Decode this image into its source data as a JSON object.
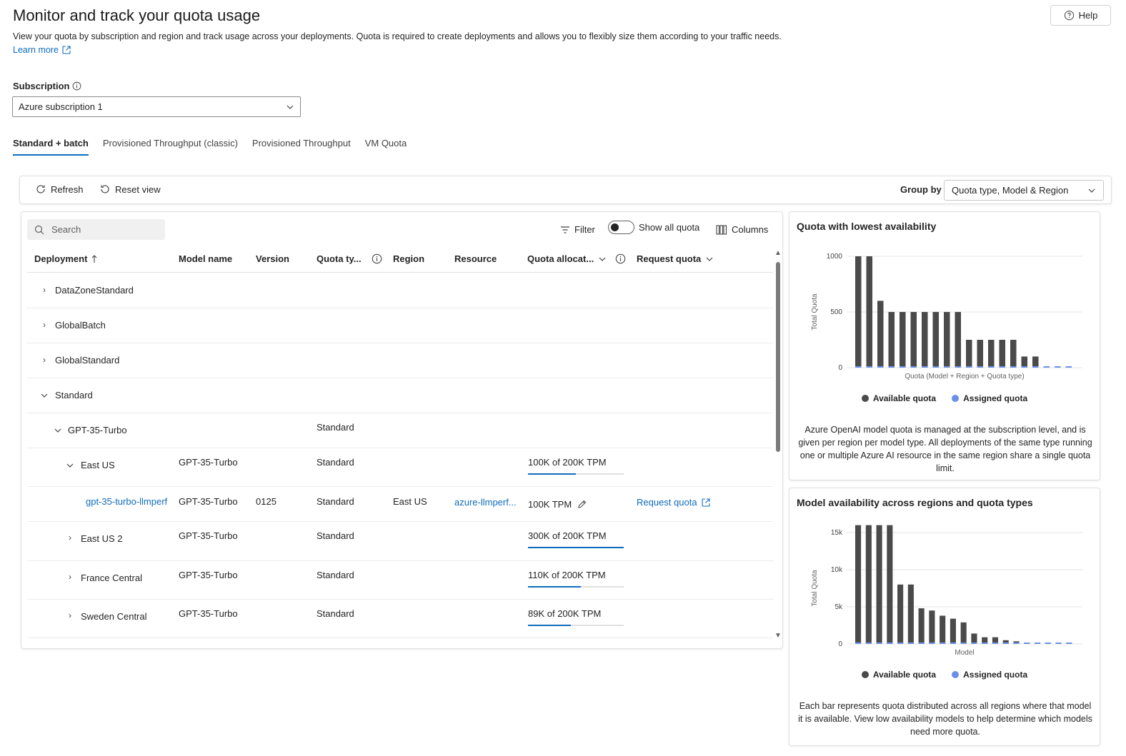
{
  "page": {
    "title": "Monitor and track your quota usage",
    "description": "View your quota by subscription and region and track usage across your deployments. Quota is required to create deployments and allows you to flexibly size them according to your traffic needs.",
    "learn_more": "Learn more",
    "help": "Help"
  },
  "subscription": {
    "label": "Subscription",
    "value": "Azure subscription 1"
  },
  "tabs": [
    {
      "label": "Standard + batch",
      "active": true
    },
    {
      "label": "Provisioned Throughput (classic)",
      "active": false
    },
    {
      "label": "Provisioned Throughput",
      "active": false
    },
    {
      "label": "VM Quota",
      "active": false
    }
  ],
  "toolbar": {
    "refresh": "Refresh",
    "reset_view": "Reset view",
    "group_by_label": "Group by",
    "group_by_value": "Quota type, Model & Region"
  },
  "table": {
    "search_placeholder": "Search",
    "filter": "Filter",
    "show_all_quota": "Show all quota",
    "columns": "Columns",
    "headers": {
      "deployment": "Deployment",
      "model_name": "Model name",
      "version": "Version",
      "quota_type": "Quota ty...",
      "region": "Region",
      "resource": "Resource",
      "quota_allocation": "Quota allocat...",
      "request_quota": "Request quota"
    },
    "groups": {
      "g1": "DataZoneStandard",
      "g2": "GlobalBatch",
      "g3": "GlobalStandard",
      "g4": "Standard"
    },
    "model_row": {
      "name": "GPT-35-Turbo",
      "quota_type": "Standard"
    },
    "region_rows": [
      {
        "name": "East US",
        "model": "GPT-35-Turbo",
        "quota_type": "Standard",
        "allocation": "100K of 200K TPM",
        "usage": 0.5
      },
      {
        "name": "East US 2",
        "model": "GPT-35-Turbo",
        "quota_type": "Standard",
        "allocation": "300K of 200K TPM",
        "usage": 1.0
      },
      {
        "name": "France Central",
        "model": "GPT-35-Turbo",
        "quota_type": "Standard",
        "allocation": "110K of 200K TPM",
        "usage": 0.55
      },
      {
        "name": "Sweden Central",
        "model": "GPT-35-Turbo",
        "quota_type": "Standard",
        "allocation": "89K of 200K TPM",
        "usage": 0.445
      }
    ],
    "deployment_row": {
      "name": "gpt-35-turbo-llmperf",
      "model": "GPT-35-Turbo",
      "version": "0125",
      "quota_type": "Standard",
      "region": "East US",
      "resource": "azure-llmperf...",
      "allocation": "100K TPM",
      "request": "Request quota"
    }
  },
  "charts": {
    "lowest": {
      "title": "Quota with lowest availability",
      "note": "Azure OpenAI model quota is managed at the subscription level, and is given per region per model type. All deployments of the same type running one or multiple Azure AI resource in the same region share a single quota limit."
    },
    "models": {
      "title": "Model availability across regions and quota types",
      "note": "Each bar represents quota distributed across all regions where that model it is available. View low availability models to help determine which models need more quota."
    },
    "legend": {
      "available": "Available quota",
      "assigned": "Assigned quota"
    },
    "colors": {
      "available": "#4a4a4a",
      "assigned": "#6b8fe8"
    }
  },
  "chart_data": [
    {
      "type": "bar",
      "title": "Quota with lowest availability",
      "xlabel": "Quota (Model + Region + Quota type)",
      "ylabel": "Total Quota",
      "ylim": [
        0,
        1000
      ],
      "yticks": [
        "0",
        "500",
        "1000"
      ],
      "series": [
        {
          "name": "Available quota",
          "values": [
            1000,
            1000,
            600,
            500,
            500,
            500,
            500,
            500,
            500,
            500,
            250,
            250,
            250,
            250,
            250,
            100,
            100,
            0,
            0,
            0
          ]
        },
        {
          "name": "Assigned quota",
          "values": [
            0,
            0,
            0,
            0,
            0,
            0,
            0,
            0,
            0,
            0,
            0,
            0,
            0,
            0,
            0,
            0,
            0,
            0,
            0,
            0
          ]
        }
      ]
    },
    {
      "type": "bar",
      "title": "Model availability across regions and quota types",
      "xlabel": "Model",
      "ylabel": "Total Quota",
      "ylim": [
        0,
        15000
      ],
      "yticks": [
        "0",
        "5k",
        "10k",
        "15k"
      ],
      "series": [
        {
          "name": "Available quota",
          "values": [
            16000,
            16000,
            16000,
            16000,
            8000,
            8000,
            4800,
            4500,
            3800,
            3400,
            2900,
            1400,
            900,
            900,
            500,
            350,
            150,
            100,
            100,
            100,
            100
          ]
        },
        {
          "name": "Assigned quota",
          "values": [
            100,
            100,
            100,
            100,
            100,
            100,
            100,
            100,
            100,
            100,
            100,
            100,
            100,
            100,
            100,
            100,
            100,
            100,
            100,
            100,
            100
          ]
        }
      ]
    }
  ]
}
